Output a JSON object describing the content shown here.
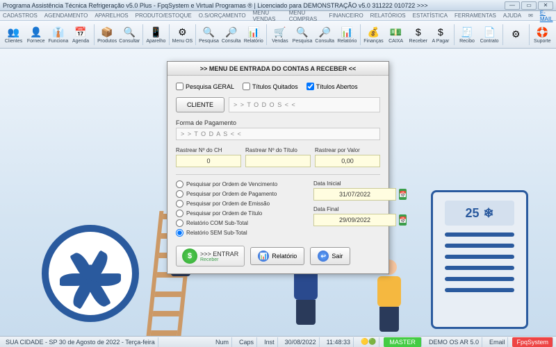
{
  "window": {
    "title": "Programa Assistência Técnica Refrigeração v5.0 Plus - FpqSystem e Virtual Programas ® | Licenciado para  DEMONSTRAÇÃO v5.0 311222 010722 >>>"
  },
  "menu": {
    "items": [
      "CADASTROS",
      "AGENDAMENTO",
      "APARELHOS",
      "PRODUTO/ESTOQUE",
      "O.S/ORÇAMENTO",
      "MENU VENDAS",
      "MENU COMPRAS",
      "FINANCEIRO",
      "RELATÓRIOS",
      "ESTATÍSTICA",
      "FERRAMENTAS",
      "AJUDA"
    ],
    "email": "E-MAIL"
  },
  "toolbar": {
    "buttons": [
      {
        "label": "Clientes",
        "icon": "👥"
      },
      {
        "label": "Fornece",
        "icon": "👤"
      },
      {
        "label": "Funciona",
        "icon": "👔"
      },
      {
        "label": "Agenda",
        "icon": "📅"
      },
      {
        "label": "Produtos",
        "icon": "📦"
      },
      {
        "label": "Consultar",
        "icon": "🔍"
      },
      {
        "label": "Aparelho",
        "icon": "📱"
      },
      {
        "label": "Menu OS",
        "icon": "⚙"
      },
      {
        "label": "Pesquisa",
        "icon": "🔍"
      },
      {
        "label": "Consulta",
        "icon": "🔎"
      },
      {
        "label": "Relatório",
        "icon": "📊"
      },
      {
        "label": "Vendas",
        "icon": "🛒"
      },
      {
        "label": "Pesquisa",
        "icon": "🔍"
      },
      {
        "label": "Consulta",
        "icon": "🔎"
      },
      {
        "label": "Relatório",
        "icon": "📊"
      },
      {
        "label": "Finanças",
        "icon": "💰"
      },
      {
        "label": "CAIXA",
        "icon": "💵"
      },
      {
        "label": "Receber",
        "icon": "$"
      },
      {
        "label": "A Pagar",
        "icon": "$"
      },
      {
        "label": "Recibo",
        "icon": "🧾"
      },
      {
        "label": "Contrato",
        "icon": "📄"
      },
      {
        "label": "",
        "icon": "⚙"
      },
      {
        "label": "Suporte",
        "icon": "🛟"
      }
    ]
  },
  "dialog": {
    "title": ">>  MENU DE ENTRADA DO CONTAS A RECEBER  <<",
    "chk_geral": "Pesquisa GERAL",
    "chk_quitados": "Títulos Quitados",
    "chk_abertos": "Títulos Abertos",
    "btn_cliente": "CLIENTE",
    "cliente_val": "> > T O D O S < <",
    "fp_label": "Forma de Pagamento",
    "fp_val": "> > T O D A S < <",
    "track_ch_lbl": "Rastrear Nº do CH",
    "track_ch_val": "0",
    "track_tit_lbl": "Rastrear Nº do Título",
    "track_tit_val": "",
    "track_val_lbl": "Rastrear por Valor",
    "track_val_val": "0,00",
    "radios": [
      "Pesquisar por Ordem de Vencimento",
      "Pesquisar por Ordem de Pagamento",
      "Pesquisar por Ordem de Emissão",
      "Pesquisar por Ordem de Título",
      "Relatório COM Sub-Total",
      "Relatório SEM Sub-Total"
    ],
    "data_inicial_lbl": "Data Inicial",
    "data_inicial": "31/07/2022",
    "data_final_lbl": "Data Final",
    "data_final": "29/09/2022",
    "btn_entrar": ">>> ENTRAR",
    "btn_entrar_sub": "Receber",
    "btn_relatorio": "Relatório",
    "btn_sair": "Sair"
  },
  "ac": {
    "temp": "25"
  },
  "status": {
    "city": "SUA CIDADE - SP 30 de Agosto de 2022 - Terça-feira",
    "num": "Num",
    "caps": "Caps",
    "inst": "Inst",
    "date": "30/08/2022",
    "time": "11:48:33",
    "master": "MASTER",
    "demo": "DEMO OS AR 5.0",
    "email": "Email",
    "fpq": "FpqSystem"
  }
}
